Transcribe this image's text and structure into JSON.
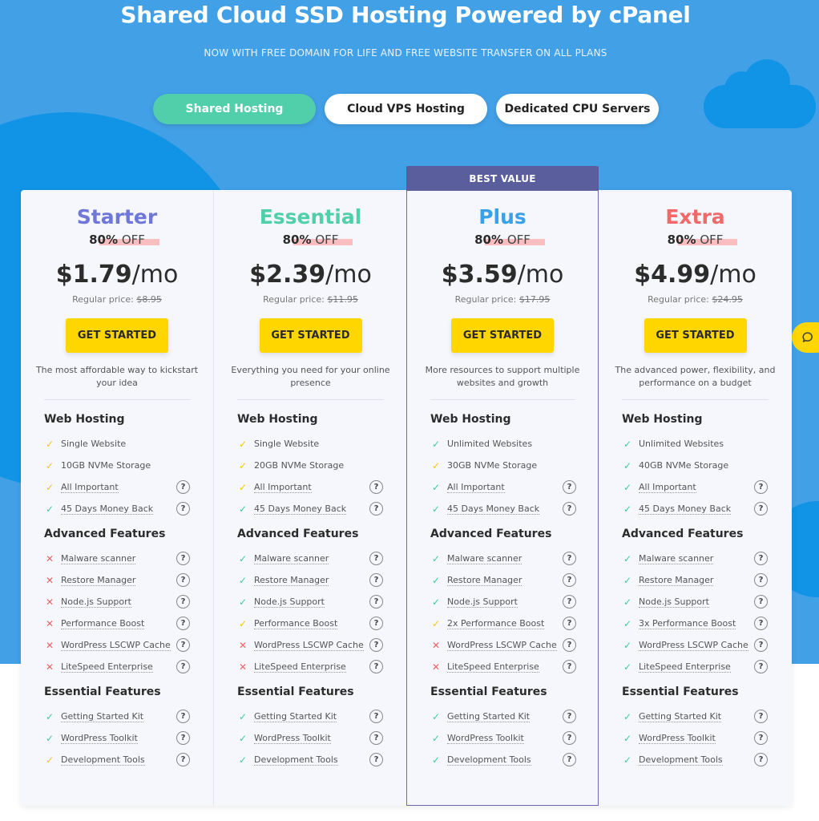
{
  "header": {
    "title": "Shared Cloud SSD Hosting Powered by cPanel",
    "subtitle": "NOW WITH FREE DOMAIN FOR LIFE AND FREE WEBSITE TRANSFER ON ALL PLANS"
  },
  "tabs": [
    {
      "label": "Shared Hosting",
      "active": true
    },
    {
      "label": "Cloud VPS Hosting",
      "active": false
    },
    {
      "label": "Dedicated CPU Servers",
      "active": false
    }
  ],
  "colors": {
    "hero_bg": "#42a0e6",
    "active_tab": "#50cfaa",
    "cta": "#ffd600",
    "best_value_badge": "#5a5e9c",
    "check_green": "#3ec9a0",
    "check_yellow": "#f5c518",
    "cross_red": "#f06262"
  },
  "chat": {
    "icon": "chat-bubble-icon"
  },
  "plans": [
    {
      "name": "Starter",
      "color": "#6f78d8",
      "discount_pct": "80%",
      "discount_word": "OFF",
      "price": "$1.79",
      "per": "/mo",
      "regular_label": "Regular price:",
      "regular_price": "$8.95",
      "cta": "GET STARTED",
      "desc": "The most affordable way to kickstart your idea",
      "sections": [
        {
          "title": "Web Hosting",
          "features": [
            {
              "text": "Single Website",
              "status": "yellow",
              "help": false
            },
            {
              "text": "10GB NVMe Storage",
              "status": "yellow",
              "help": false
            },
            {
              "text": "All Important",
              "status": "yellow",
              "help": true
            },
            {
              "text": "45 Days Money Back",
              "status": "green",
              "help": true
            }
          ]
        },
        {
          "title": "Advanced Features",
          "features": [
            {
              "text": "Malware scanner",
              "status": "red",
              "help": true
            },
            {
              "text": "Restore Manager",
              "status": "red",
              "help": true
            },
            {
              "text": "Node.js Support",
              "status": "red",
              "help": true
            },
            {
              "text": "Performance Boost",
              "status": "red",
              "help": true
            },
            {
              "text": "WordPress LSCWP Cache",
              "status": "red",
              "help": true
            },
            {
              "text": "LiteSpeed Enterprise",
              "status": "red",
              "help": true
            }
          ]
        },
        {
          "title": "Essential Features",
          "features": [
            {
              "text": "Getting Started Kit",
              "status": "green",
              "help": true
            },
            {
              "text": "WordPress Toolkit",
              "status": "green",
              "help": true
            },
            {
              "text": "Development Tools",
              "status": "yellow",
              "help": true
            }
          ]
        }
      ]
    },
    {
      "name": "Essential",
      "color": "#50cfaa",
      "discount_pct": "80%",
      "discount_word": "OFF",
      "price": "$2.39",
      "per": "/mo",
      "regular_label": "Regular price:",
      "regular_price": "$11.95",
      "cta": "GET STARTED",
      "desc": "Everything you need for your online presence",
      "sections": [
        {
          "title": "Web Hosting",
          "features": [
            {
              "text": "Single Website",
              "status": "yellow",
              "help": false
            },
            {
              "text": "20GB NVMe Storage",
              "status": "yellow",
              "help": false
            },
            {
              "text": "All Important",
              "status": "yellow",
              "help": true
            },
            {
              "text": "45 Days Money Back",
              "status": "green",
              "help": true
            }
          ]
        },
        {
          "title": "Advanced Features",
          "features": [
            {
              "text": "Malware scanner",
              "status": "green",
              "help": true
            },
            {
              "text": "Restore Manager",
              "status": "green",
              "help": true
            },
            {
              "text": "Node.js Support",
              "status": "green",
              "help": true
            },
            {
              "text": "Performance Boost",
              "status": "yellow",
              "help": true
            },
            {
              "text": "WordPress LSCWP Cache",
              "status": "red",
              "help": true
            },
            {
              "text": "LiteSpeed Enterprise",
              "status": "red",
              "help": true
            }
          ]
        },
        {
          "title": "Essential Features",
          "features": [
            {
              "text": "Getting Started Kit",
              "status": "green",
              "help": true
            },
            {
              "text": "WordPress Toolkit",
              "status": "green",
              "help": true
            },
            {
              "text": "Development Tools",
              "status": "green",
              "help": true
            }
          ]
        }
      ]
    },
    {
      "name": "Plus",
      "color": "#3aa0e8",
      "badge": "BEST VALUE",
      "discount_pct": "80%",
      "discount_word": "OFF",
      "price": "$3.59",
      "per": "/mo",
      "regular_label": "Regular price:",
      "regular_price": "$17.95",
      "cta": "GET STARTED",
      "desc": "More resources to support multiple websites and growth",
      "sections": [
        {
          "title": "Web Hosting",
          "features": [
            {
              "text": "Unlimited Websites",
              "status": "green",
              "help": false
            },
            {
              "text": "30GB NVMe Storage",
              "status": "yellow",
              "help": false
            },
            {
              "text": "All Important",
              "status": "green",
              "help": true
            },
            {
              "text": "45 Days Money Back",
              "status": "green",
              "help": true
            }
          ]
        },
        {
          "title": "Advanced Features",
          "features": [
            {
              "text": "Malware scanner",
              "status": "green",
              "help": true
            },
            {
              "text": "Restore Manager",
              "status": "green",
              "help": true
            },
            {
              "text": "Node.js Support",
              "status": "green",
              "help": true
            },
            {
              "text": "2x Performance Boost",
              "status": "yellow",
              "help": true
            },
            {
              "text": "WordPress LSCWP Cache",
              "status": "red",
              "help": true
            },
            {
              "text": "LiteSpeed Enterprise",
              "status": "red",
              "help": true
            }
          ]
        },
        {
          "title": "Essential Features",
          "features": [
            {
              "text": "Getting Started Kit",
              "status": "green",
              "help": true
            },
            {
              "text": "WordPress Toolkit",
              "status": "green",
              "help": true
            },
            {
              "text": "Development Tools",
              "status": "green",
              "help": true
            }
          ]
        }
      ]
    },
    {
      "name": "Extra",
      "color": "#f06a6a",
      "discount_pct": "80%",
      "discount_word": "OFF",
      "price": "$4.99",
      "per": "/mo",
      "regular_label": "Regular price:",
      "regular_price": "$24.95",
      "cta": "GET STARTED",
      "desc": "The advanced power, flexibility, and performance on a budget",
      "sections": [
        {
          "title": "Web Hosting",
          "features": [
            {
              "text": "Unlimited Websites",
              "status": "green",
              "help": false
            },
            {
              "text": "40GB NVMe Storage",
              "status": "green",
              "help": false
            },
            {
              "text": "All Important",
              "status": "green",
              "help": true
            },
            {
              "text": "45 Days Money Back",
              "status": "green",
              "help": true
            }
          ]
        },
        {
          "title": "Advanced Features",
          "features": [
            {
              "text": "Malware scanner",
              "status": "green",
              "help": true
            },
            {
              "text": "Restore Manager",
              "status": "green",
              "help": true
            },
            {
              "text": "Node.js Support",
              "status": "green",
              "help": true
            },
            {
              "text": "3x Performance Boost",
              "status": "green",
              "help": true
            },
            {
              "text": "WordPress LSCWP Cache",
              "status": "green",
              "help": true
            },
            {
              "text": "LiteSpeed Enterprise",
              "status": "green",
              "help": true
            }
          ]
        },
        {
          "title": "Essential Features",
          "features": [
            {
              "text": "Getting Started Kit",
              "status": "green",
              "help": true
            },
            {
              "text": "WordPress Toolkit",
              "status": "green",
              "help": true
            },
            {
              "text": "Development Tools",
              "status": "green",
              "help": true
            }
          ]
        }
      ]
    }
  ]
}
